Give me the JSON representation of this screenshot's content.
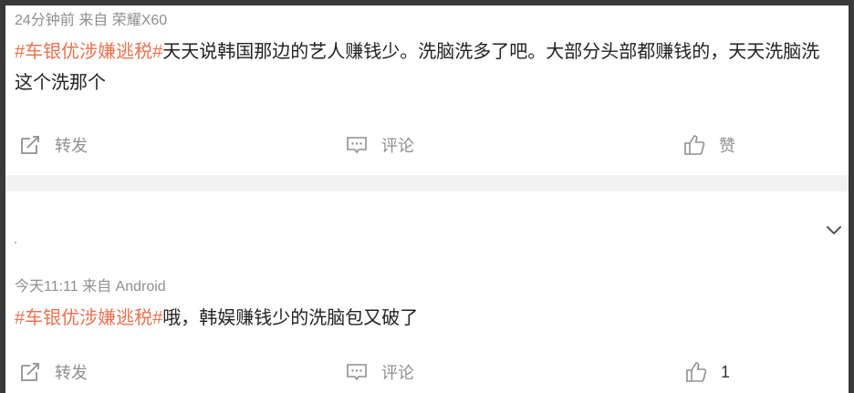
{
  "posts": [
    {
      "meta": "24分钟前  来自 荣耀X60",
      "hashtag": "#车银优涉嫌逃税#",
      "text": "天天说韩国那边的艺人赚钱少。洗脑洗多了吧。大部分头部都赚钱的，天天洗脑洗这个洗那个",
      "actions": {
        "repost": "转发",
        "comment": "评论",
        "like": "赞"
      }
    },
    {
      "meta": "今天11:11  来自 Android",
      "hashtag": "#车银优涉嫌逃税#",
      "text": "哦，韩娱赚钱少的洗脑包又破了",
      "actions": {
        "repost": "转发",
        "comment": "评论",
        "like": "1"
      }
    }
  ],
  "icons": {
    "repost": "repost-icon",
    "comment": "comment-icon",
    "like": "thumbs-up-icon",
    "expand": "chevron-down-icon"
  },
  "colors": {
    "hashtag": "#eb7350",
    "meta": "#8f8f8f",
    "text": "#222222",
    "divider": "#f2f2f2"
  }
}
